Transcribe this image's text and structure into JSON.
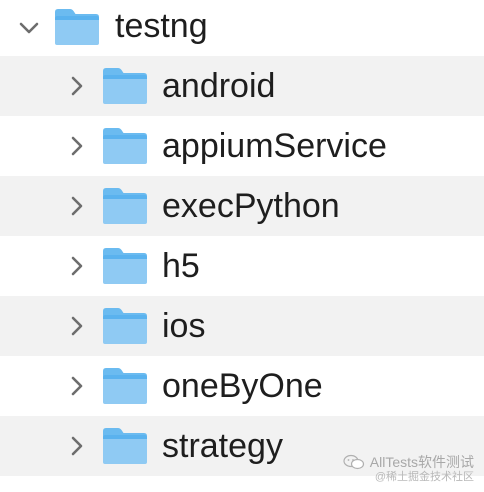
{
  "tree": {
    "root": {
      "label": "testng",
      "expanded": true,
      "icon": "folder-icon",
      "disclosure_icon": "chevron-down-icon"
    },
    "children": [
      {
        "label": "android",
        "icon": "folder-icon",
        "disclosure_icon": "chevron-right-icon"
      },
      {
        "label": "appiumService",
        "icon": "folder-icon",
        "disclosure_icon": "chevron-right-icon"
      },
      {
        "label": "execPython",
        "icon": "folder-icon",
        "disclosure_icon": "chevron-right-icon"
      },
      {
        "label": "h5",
        "icon": "folder-icon",
        "disclosure_icon": "chevron-right-icon"
      },
      {
        "label": "ios",
        "icon": "folder-icon",
        "disclosure_icon": "chevron-right-icon"
      },
      {
        "label": "oneByOne",
        "icon": "folder-icon",
        "disclosure_icon": "chevron-right-icon"
      },
      {
        "label": "strategy",
        "icon": "folder-icon",
        "disclosure_icon": "chevron-right-icon"
      }
    ]
  },
  "watermark": {
    "line1": "AllTests软件测试",
    "line2": "@稀土掘金技术社区",
    "icon": "wechat-logo-icon"
  },
  "colors": {
    "folder_light": "#8fcaf3",
    "folder_dark": "#5ab2ee",
    "folder_tab": "#6bbbf0",
    "row_alt": "#f2f2f2",
    "text": "#1e1e1e",
    "chevron": "#6d6d6d"
  }
}
